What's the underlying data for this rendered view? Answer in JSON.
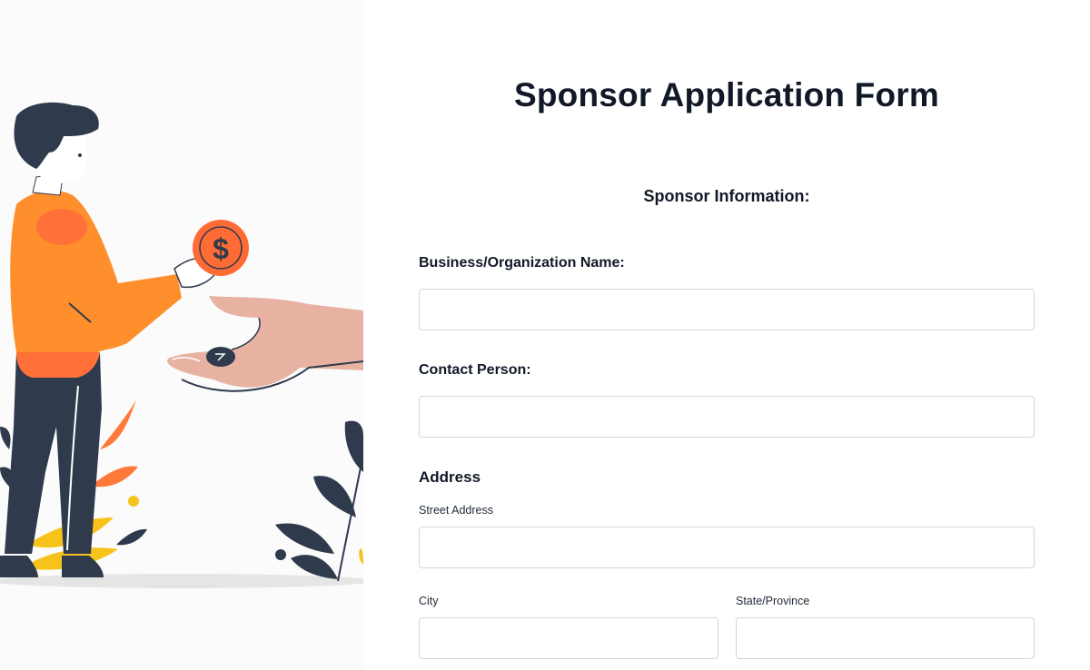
{
  "form": {
    "title": "Sponsor Application Form",
    "section_title": "Sponsor Information:",
    "business_name": {
      "label": "Business/Organization Name:",
      "value": "",
      "placeholder": ""
    },
    "contact_person": {
      "label": "Contact Person:",
      "value": "",
      "placeholder": ""
    },
    "address": {
      "title": "Address",
      "street": {
        "label": "Street Address",
        "value": "",
        "placeholder": ""
      },
      "city": {
        "label": "City",
        "value": "",
        "placeholder": ""
      },
      "state": {
        "label": "State/Province",
        "value": "",
        "placeholder": ""
      }
    }
  },
  "illustration": {
    "icon": "sponsor-donation-illustration",
    "coin_symbol": "$",
    "colors": {
      "shirt": "#ff8f2c",
      "shirt_shade": "#ff7138",
      "dark": "#2f3a4d",
      "skin_hand": "#e8b2a3",
      "coin": "#ff6b35",
      "leaf_orange": "#ff7a3a",
      "leaf_yellow": "#f7c21a",
      "ground": "#e5e5e5"
    }
  }
}
